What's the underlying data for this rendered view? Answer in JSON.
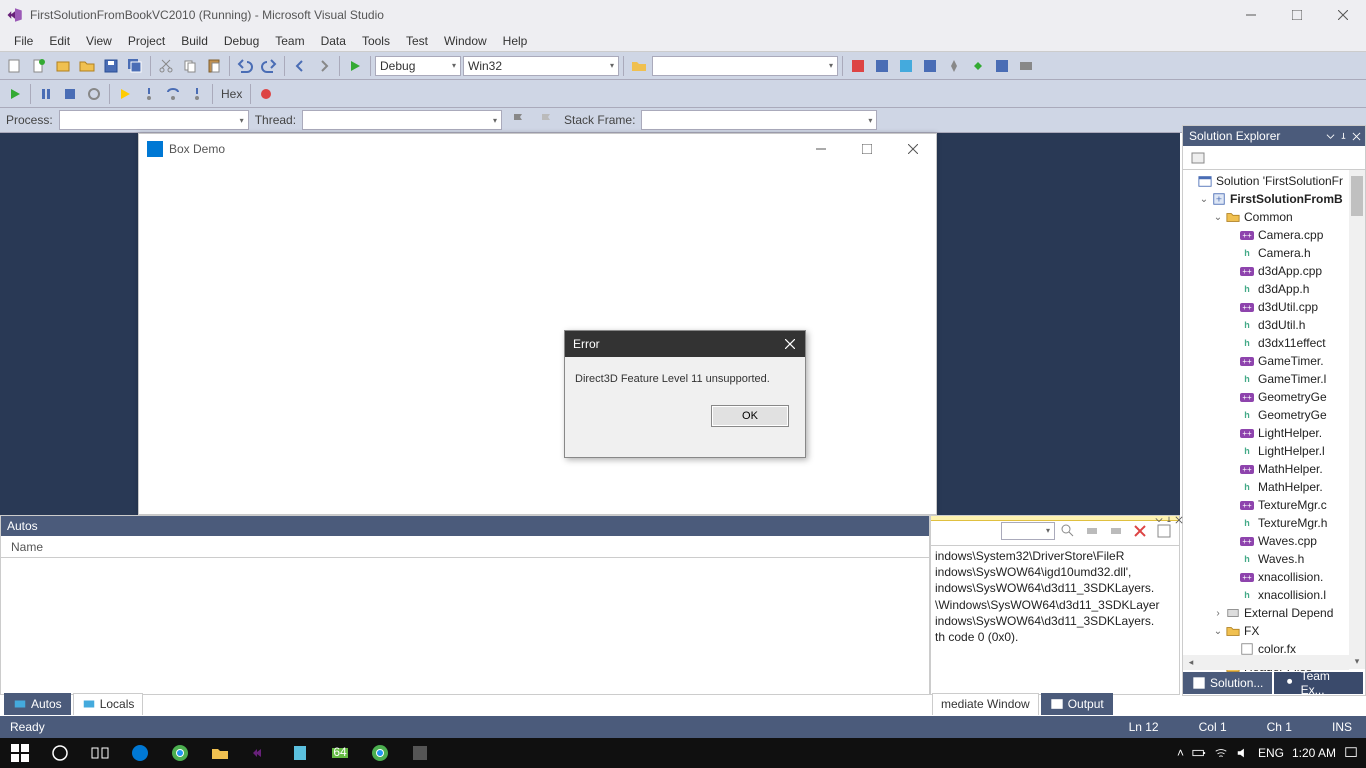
{
  "titlebar": {
    "text": "FirstSolutionFromBookVC2010 (Running) - Microsoft Visual Studio"
  },
  "menu": [
    "File",
    "Edit",
    "View",
    "Project",
    "Build",
    "Debug",
    "Team",
    "Data",
    "Tools",
    "Test",
    "Window",
    "Help"
  ],
  "toolbar": {
    "config": "Debug",
    "platform": "Win32",
    "hex": "Hex"
  },
  "debugbar": {
    "process": "Process:",
    "thread": "Thread:",
    "stackframe": "Stack Frame:"
  },
  "boxdemo": {
    "title": "Box Demo"
  },
  "error": {
    "title": "Error",
    "message": "Direct3D Feature Level 11 unsupported.",
    "ok": "OK"
  },
  "autos": {
    "title": "Autos",
    "col_name": "Name"
  },
  "output": {
    "lines": [
      "indows\\System32\\DriverStore\\FileR",
      "indows\\SysWOW64\\igd10umd32.dll',",
      "indows\\SysWOW64\\d3d11_3SDKLayers.",
      "\\Windows\\SysWOW64\\d3d11_3SDKLayer",
      "indows\\SysWOW64\\d3d11_3SDKLayers.",
      "th code 0 (0x0)."
    ]
  },
  "bottom_tabs_left": [
    "Autos",
    "Locals"
  ],
  "bottom_tabs_right": [
    "mediate Window",
    "Output"
  ],
  "solexp": {
    "title": "Solution Explorer",
    "solution": "Solution 'FirstSolutionFr",
    "project": "FirstSolutionFromB",
    "folder_common": "Common",
    "files": [
      {
        "n": "Camera.cpp",
        "t": "cpp"
      },
      {
        "n": "Camera.h",
        "t": "h"
      },
      {
        "n": "d3dApp.cpp",
        "t": "cpp"
      },
      {
        "n": "d3dApp.h",
        "t": "h"
      },
      {
        "n": "d3dUtil.cpp",
        "t": "cpp"
      },
      {
        "n": "d3dUtil.h",
        "t": "h"
      },
      {
        "n": "d3dx11effect",
        "t": "h"
      },
      {
        "n": "GameTimer.",
        "t": "cpp"
      },
      {
        "n": "GameTimer.l",
        "t": "h"
      },
      {
        "n": "GeometryGe",
        "t": "cpp"
      },
      {
        "n": "GeometryGe",
        "t": "h"
      },
      {
        "n": "LightHelper.",
        "t": "cpp"
      },
      {
        "n": "LightHelper.l",
        "t": "h"
      },
      {
        "n": "MathHelper.",
        "t": "cpp"
      },
      {
        "n": "MathHelper.",
        "t": "h"
      },
      {
        "n": "TextureMgr.c",
        "t": "cpp"
      },
      {
        "n": "TextureMgr.h",
        "t": "h"
      },
      {
        "n": "Waves.cpp",
        "t": "cpp"
      },
      {
        "n": "Waves.h",
        "t": "h"
      },
      {
        "n": "xnacollision.",
        "t": "cpp"
      },
      {
        "n": "xnacollision.l",
        "t": "h"
      }
    ],
    "external": "External Depend",
    "fx": "FX",
    "colorfx": "color.fx",
    "headers": "Header Files",
    "tab1": "Solution...",
    "tab2": "Team Ex..."
  },
  "status": {
    "ready": "Ready",
    "ln": "Ln 12",
    "col": "Col 1",
    "ch": "Ch 1",
    "ins": "INS"
  },
  "taskbar": {
    "lang": "ENG",
    "time": "1:20 AM"
  }
}
